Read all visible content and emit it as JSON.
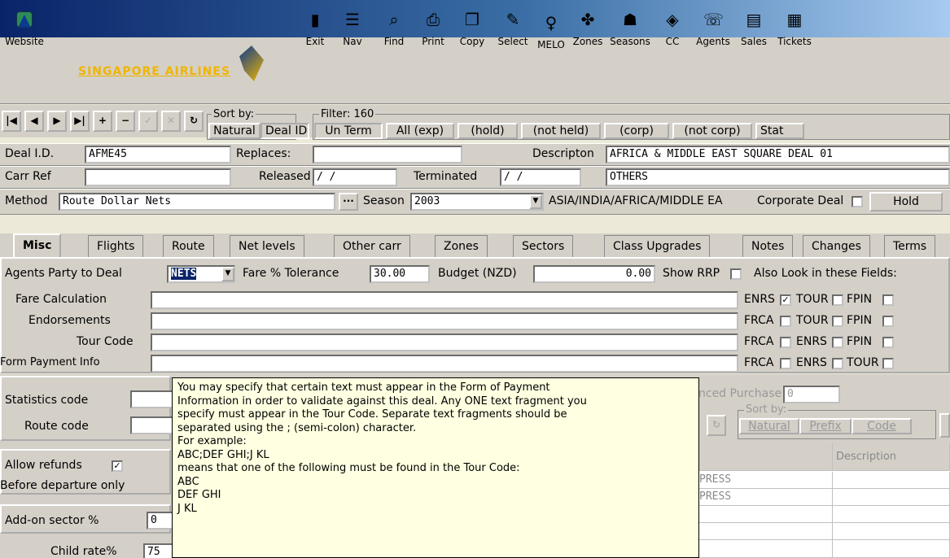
{
  "toolbar": {
    "website_label": "Website",
    "logo_text": "SINGAPORE AIRLINES",
    "buttons": [
      {
        "label": "Exit",
        "icon": "exit-icon"
      },
      {
        "label": "Nav",
        "icon": "nav-icon"
      },
      {
        "label": "Find",
        "icon": "find-icon"
      },
      {
        "label": "Print",
        "icon": "print-icon"
      },
      {
        "label": "Copy",
        "icon": "copy-icon"
      },
      {
        "label": "Select",
        "icon": "select-icon"
      },
      {
        "label": "MELO",
        "icon": "melo-icon"
      },
      {
        "label": "Zones",
        "icon": "zones-icon"
      },
      {
        "label": "Seasons",
        "icon": "seasons-icon"
      },
      {
        "label": "CC",
        "icon": "cc-icon"
      },
      {
        "label": "Agents",
        "icon": "agents-icon"
      },
      {
        "label": "Sales",
        "icon": "sales-icon"
      },
      {
        "label": "Tickets",
        "icon": "tickets-icon"
      }
    ]
  },
  "nav": {
    "sort_legend": "Sort by:",
    "sort_natural": "Natural",
    "sort_deal_id": "Deal ID",
    "filter_legend": "Filter: 160",
    "filters": [
      "Un Term",
      "All (exp)",
      "(hold)",
      "(not held)",
      "(corp)",
      "(not corp)",
      "Stat"
    ]
  },
  "deal": {
    "deal_id_label": "Deal I.D.",
    "deal_id_value": "AFME45",
    "replaces_label": "Replaces:",
    "replaces_value": "",
    "description_label": "Descripton",
    "description_value": "AFRICA & MIDDLE EAST SQUARE DEAL 01",
    "carr_ref_label": "Carr Ref",
    "carr_ref_value": "",
    "released_label": "Released",
    "released_value": " /  /",
    "terminated_label": "Terminated",
    "terminated_value": " /  /",
    "description2_value": "OTHERS",
    "method_label": "Method",
    "method_value": "Route Dollar Nets",
    "season_label": "Season",
    "season_value": "2003",
    "region_text": "ASIA/INDIA/AFRICA/MIDDLE EA",
    "corporate_label": "Corporate Deal",
    "hold_button": "Hold"
  },
  "tabs": [
    "Misc",
    "Flights",
    "Route",
    "Net levels",
    "Other carr",
    "Zones",
    "Sectors",
    "Class Upgrades",
    "Notes",
    "Changes",
    "Terms"
  ],
  "misc": {
    "agents_party_label": "Agents Party to Deal",
    "agents_party_value": "NETS",
    "fare_tol_label": "Fare % Tolerance",
    "fare_tol_value": "30.00",
    "budget_label": "Budget (NZD)",
    "budget_value": "0.00",
    "show_rrp_label": "Show RRP",
    "also_look_label": "Also Look in these Fields:",
    "fields": [
      {
        "label": "Fare Calculation",
        "checks": [
          "ENRS",
          "TOUR",
          "FPIN"
        ],
        "checked": [
          true,
          false,
          false
        ]
      },
      {
        "label": "Endorsements",
        "checks": [
          "FRCA",
          "TOUR",
          "FPIN"
        ],
        "checked": [
          false,
          false,
          false
        ]
      },
      {
        "label": "Tour Code",
        "checks": [
          "FRCA",
          "ENRS",
          "FPIN"
        ],
        "checked": [
          false,
          false,
          false
        ]
      },
      {
        "label": "Form Payment Info",
        "checks": [
          "FRCA",
          "ENRS",
          "TOUR"
        ],
        "checked": [
          false,
          false,
          false
        ]
      }
    ]
  },
  "lower": {
    "statistics_label": "Statistics code",
    "route_label": "Route code",
    "allow_refunds_label": "Allow refunds",
    "before_departure_label": "Before departure only",
    "addon_label": "Add-on sector %",
    "addon_value": "0",
    "child_rate_label": "Child rate%",
    "child_rate_value": "75",
    "adv_purchase_label": "nced Purchase",
    "adv_purchase_value": "0",
    "sort_legend": "Sort by:",
    "sort_natural": "Natural",
    "sort_prefix": "Prefix",
    "sort_code": "Code",
    "grid_header": "Description",
    "grid_rows": [
      "PRESS",
      "PRESS"
    ]
  },
  "tooltip": [
    "You may specify that certain text must appear in the Form of Payment",
    "Information in order to validate against this deal.  Any ONE text fragment you",
    "specify must appear in the Tour Code. Separate text fragments should be",
    "separated using the ; (semi-colon) character.",
    "For example:",
    "ABC;DEF GHI;J KL",
    "means that one of the following must be found in the Tour Code:",
    "ABC",
    "DEF GHI",
    "J KL"
  ]
}
